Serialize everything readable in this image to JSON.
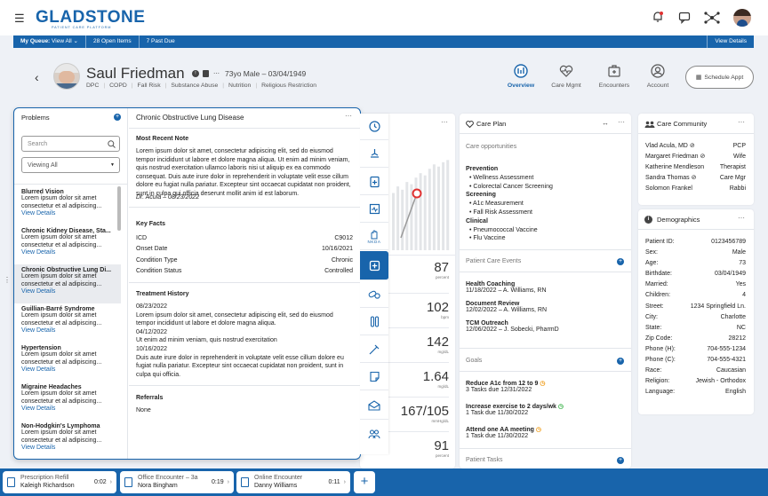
{
  "app": {
    "logo": "GLADSTONE",
    "tagline": "PATIENT CARE PLATFORM"
  },
  "queue": {
    "label": "My Queue:",
    "view": "View All",
    "open": "28 Open Items",
    "past": "7 Past Due",
    "details": "View Details"
  },
  "patient": {
    "name": "Saul Friedman",
    "info": "73yo Male – 03/04/1949",
    "tags": [
      "DPC",
      "COPD",
      "Fall Risk",
      "Substance Abuse",
      "Nutrition",
      "Religious Restriction"
    ]
  },
  "nav": {
    "tabs": [
      "Overview",
      "Care Mgmt",
      "Encounters",
      "Account"
    ],
    "schedule": "Schedule Appt"
  },
  "problems": {
    "title": "Problems",
    "search_placeholder": "Search",
    "filter": "Viewing All",
    "snippet": "Lorem ipsum dolor sit amet consectetur et al adipiscing...",
    "link": "View Details",
    "items": [
      "Blurred Vision",
      "Chronic Kidney Disease, Sta...",
      "Chronic Obstructive Lung Di...",
      "Guillian-Barré Syndrome",
      "Hypertension",
      "Migraine Headaches",
      "Non-Hodgkin's Lymphoma"
    ]
  },
  "detail": {
    "title": "Chronic Obstructive Lung Disease",
    "recent_note_h": "Most Recent Note",
    "note": "Lorem ipsum dolor sit amet, consectetur adipiscing elit, sed do eiusmod tempor incididunt ut labore et dolore magna aliqua. Ut enim ad minim veniam, quis nostrud exercitation ullamco laboris nisi ut aliquip ex ea commodo consequat. Duis aute irure dolor in reprehenderit in voluptate velit esse cillum dolore eu fugiat nulla pariatur. Excepteur sint occaecat cupidatat non proident, sunt in culpa qui officia deserunt mollit anim id est laborum.",
    "note_sig": "Dr. Acula – 08/23/2022",
    "key_facts_h": "Key Facts",
    "facts": [
      {
        "k": "ICD",
        "v": "C9012"
      },
      {
        "k": "Onset Date",
        "v": "10/16/2021"
      },
      {
        "k": "Condition Type",
        "v": "Chronic"
      },
      {
        "k": "Condition Status",
        "v": "Controlled"
      }
    ],
    "history_h": "Treatment History",
    "history": [
      {
        "date": "08/23/2022",
        "text": "Lorem ipsum dolor sit amet, consectetur adipiscing elit, sed do eiusmod tempor incididunt ut labore et dolore magna aliqua."
      },
      {
        "date": "04/12/2022",
        "text": "Ut enim ad minim veniam, quis nostrud exercitation"
      },
      {
        "date": "10/16/2022",
        "text": "Duis aute irure dolor in reprehenderit in voluptate velit esse cillum dolore eu fugiat nulla pariatur. Excepteur sint occaecat cupidatat non proident, sunt in culpa qui officia."
      }
    ],
    "referrals_h": "Referrals",
    "referrals": "None"
  },
  "rail": {
    "nkda": "NKDA"
  },
  "vitals": [
    {
      "v": "87",
      "u": "percent"
    },
    {
      "v": "102",
      "u": "bpm"
    },
    {
      "v": "142",
      "u": "mg/dL"
    },
    {
      "v": "1.64",
      "u": "mg/dL"
    },
    {
      "v": "167/105",
      "u": "mmHg/dL"
    },
    {
      "v": "91",
      "u": "percent"
    }
  ],
  "chart_data": {
    "type": "bar",
    "values": [
      52,
      58,
      55,
      62,
      60,
      66,
      70,
      68,
      74,
      78,
      76,
      80,
      82
    ]
  },
  "careplan": {
    "title": "Care Plan",
    "opps": "Care opportunities",
    "groups": [
      {
        "h": "Prevention",
        "items": [
          "Wellness Assessment",
          "Colorectal Cancer Screening"
        ]
      },
      {
        "h": "Screening",
        "items": [
          "A1c Measurement",
          "Fall Risk Assessment"
        ]
      },
      {
        "h": "Clinical",
        "items": [
          "Pneumococcal Vaccine",
          "Flu Vaccine"
        ]
      }
    ],
    "events_h": "Patient Care Events",
    "events": [
      {
        "h": "Health Coaching",
        "d": "11/18/2022 – A. Williams, RN"
      },
      {
        "h": "Document Review",
        "d": "12/02/2022 – A. Williams, RN"
      },
      {
        "h": "TCM Outreach",
        "d": "12/06/2022 – J. Sobecki, PharmD"
      }
    ],
    "goals_h": "Goals",
    "goals": [
      {
        "h": "Reduce A1c from 12 to 9",
        "d": "3 Tasks due 12/31/2022",
        "c": "#f0a020"
      },
      {
        "h": "Increase exercise to 2 days/wk",
        "d": "1 Task due 11/30/2022",
        "c": "#3cb44b"
      },
      {
        "h": "Attend one AA meeting",
        "d": "1 Task due 11/30/2022",
        "c": "#f0a020"
      }
    ],
    "tasks_h": "Patient Tasks"
  },
  "community": {
    "title": "Care Community",
    "people": [
      {
        "n": "Vlad Acula, MD",
        "r": "PCP",
        "c": true
      },
      {
        "n": "Margaret Friedman",
        "r": "Wife",
        "c": true
      },
      {
        "n": "Katherine Mendleson",
        "r": "Therapist",
        "c": false
      },
      {
        "n": "Sandra Thomas",
        "r": "Care Mgr",
        "c": true
      },
      {
        "n": "Solomon Frankel",
        "r": "Rabbi",
        "c": false
      }
    ]
  },
  "demographics": {
    "title": "Demographics",
    "rows": [
      {
        "k": "Patient ID:",
        "v": "0123456789"
      },
      {
        "k": "Sex:",
        "v": "Male"
      },
      {
        "k": "Age:",
        "v": "73"
      },
      {
        "k": "Birthdate:",
        "v": "03/04/1949"
      },
      {
        "k": "Married:",
        "v": "Yes"
      },
      {
        "k": "Children:",
        "v": "4"
      },
      {
        "k": "Street:",
        "v": "1234 Springfield Ln."
      },
      {
        "k": "City:",
        "v": "Charlotte"
      },
      {
        "k": "State:",
        "v": "NC"
      },
      {
        "k": "Zip Code:",
        "v": "28212"
      },
      {
        "k": "Phone (H):",
        "v": "704-555-1234"
      },
      {
        "k": "Phone (C):",
        "v": "704-555-4321"
      },
      {
        "k": "Race:",
        "v": "Caucasian"
      },
      {
        "k": "Religion:",
        "v": "Jewish - Orthodox"
      },
      {
        "k": "Language:",
        "v": "English"
      }
    ]
  },
  "tray": [
    {
      "t": "Prescription Refill",
      "n": "Kaleigh Richardson",
      "time": "0:02"
    },
    {
      "t": "Office Encounter – 3a",
      "n": "Nora Bingham",
      "time": "0:19"
    },
    {
      "t": "Online Encounter",
      "n": "Danny Williams",
      "time": "0:11"
    }
  ]
}
